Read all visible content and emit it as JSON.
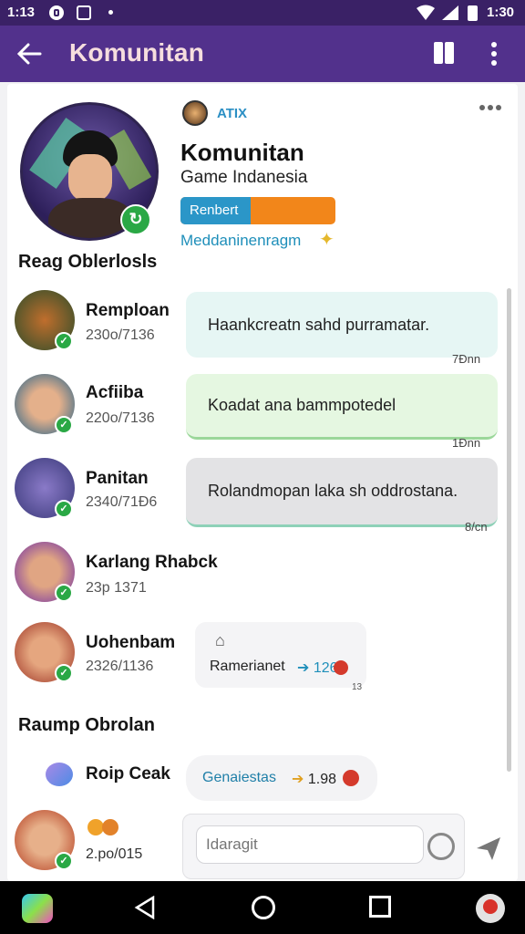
{
  "status_bar": {
    "time_left": "1:13",
    "time_right": "1:30",
    "icons": [
      "media-icon",
      "gallery-icon",
      "dot-icon",
      "wifi-icon",
      "signal-icon",
      "battery-icon"
    ]
  },
  "app_bar": {
    "title": "Komunitan",
    "icons": [
      "back-arrow-icon",
      "split-view-icon",
      "more-vertical-icon"
    ],
    "bg_color": "#52318c"
  },
  "profile": {
    "small_label": "ATIX",
    "title": "Komunitan",
    "subtitle": "Game Indanesia",
    "progress_label": "Renbert",
    "progress_fraction": 0.45,
    "link_text": "Meddaninenragm",
    "progress_colors": [
      "#2b96c8",
      "#f2861a"
    ]
  },
  "sections": {
    "recent": "Reag Oblerlosls",
    "rooms": "Raump Obrolan"
  },
  "chats": [
    {
      "name": "Remploan",
      "meta": "230o/7136",
      "message": "Haankcreatn sahd purramatar.",
      "time": "7Ðnn",
      "bubble": "#e6f6f4"
    },
    {
      "name": "Acfiiba",
      "meta": "220o/7136",
      "message": "Koadat ana bammpotedel",
      "time": "1Ðnn",
      "bubble": "#e5f7e1"
    },
    {
      "name": "Panitan",
      "meta": "2340/71Ð6",
      "message": "Rolandmopan laka sh oddrostana.",
      "time": "8/cn",
      "bubble": "#e3e3e5"
    },
    {
      "name": "Karlang Rhabck",
      "meta": "23p 1371"
    },
    {
      "name": "Uohenbam",
      "meta": "2326/1136",
      "reaction_text": "Ramerianet",
      "reaction_count": "126",
      "reaction_time": "13"
    }
  ],
  "room": {
    "name": "Roip Ceak",
    "chip_text": "Genaiestas",
    "chip_count": "1.98"
  },
  "composer": {
    "meta": "2.po/015",
    "placeholder": "Idaragit",
    "send_icon": "send-icon"
  },
  "nav_bar": {
    "icons": [
      "app-logo-icon",
      "back-triangle-icon",
      "home-circle-icon",
      "recents-square-icon",
      "profile-app-icon"
    ]
  }
}
